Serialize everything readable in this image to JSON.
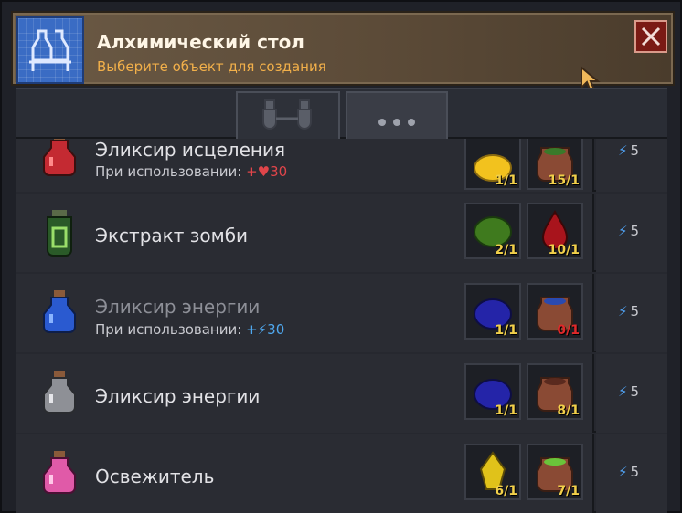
{
  "header": {
    "title": "Алхимический стол",
    "subtitle": "Выберите объект для создания",
    "icon": "blueprint-icon"
  },
  "tabs": [
    {
      "label": "",
      "icon": "flasks-icon"
    },
    {
      "label": "•••",
      "icon": "more-icon",
      "active": true
    }
  ],
  "recipes": [
    {
      "name": "Эликсир исцеления",
      "effect_label": "При использовании:",
      "effect_value": "+♥30",
      "ingredients": [
        {
          "icon": "gold-powder-icon",
          "count": "1/1"
        },
        {
          "icon": "pot-icon",
          "count": "15/1"
        }
      ],
      "energy": "5"
    },
    {
      "name": "Экстракт зомби",
      "ingredients": [
        {
          "icon": "green-moss-icon",
          "count": "2/1"
        },
        {
          "icon": "blood-drop-icon",
          "count": "10/1"
        }
      ],
      "energy": "5"
    },
    {
      "name": "Эликсир энергии",
      "effect_label": "При использовании:",
      "effect_value": "+⚡30",
      "ingredients": [
        {
          "icon": "blue-powder-icon",
          "count": "1/1"
        },
        {
          "icon": "water-pot-icon",
          "count": "0/1"
        }
      ],
      "energy": "5"
    },
    {
      "name": "Эликсир энергии",
      "ingredients": [
        {
          "icon": "blue-powder-icon",
          "count": "1/1"
        },
        {
          "icon": "pot-icon",
          "count": "8/1"
        }
      ],
      "energy": "5"
    },
    {
      "name": "Освежитель",
      "ingredients": [
        {
          "icon": "yellow-gem-icon",
          "count": "6/1"
        },
        {
          "icon": "green-pot-icon",
          "count": "7/1"
        }
      ],
      "energy": "5"
    }
  ],
  "colors": {
    "accent": "#f2b04a",
    "energy": "#4f9fef",
    "health": "#e0454a"
  }
}
